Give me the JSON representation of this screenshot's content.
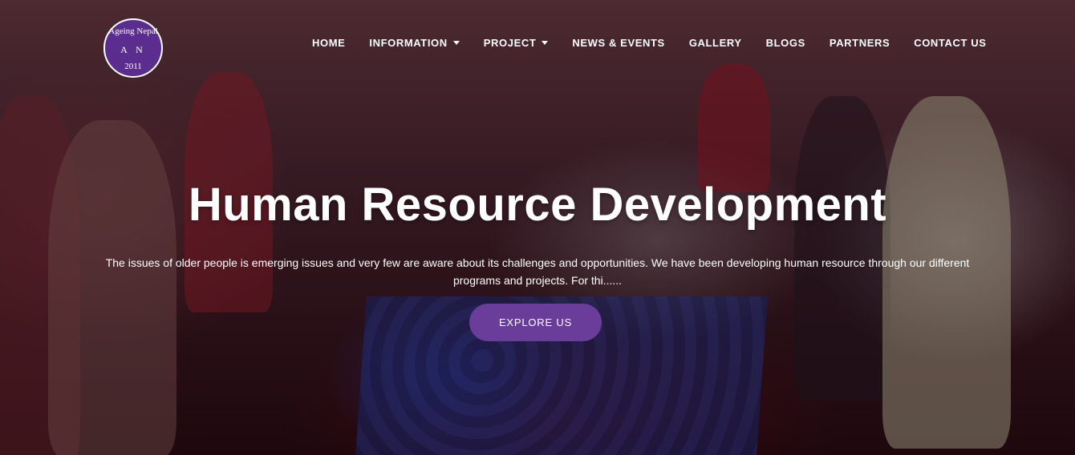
{
  "logo": {
    "text_top": "Ageing Nepal",
    "text_mid": "A N",
    "text_year": "2011",
    "color": "#5b2d8e"
  },
  "nav": {
    "items": [
      {
        "label": "HOME",
        "dropdown": false
      },
      {
        "label": "INFORMATION",
        "dropdown": true
      },
      {
        "label": "PROJECT",
        "dropdown": true
      },
      {
        "label": "NEWS & EVENTS",
        "dropdown": false
      },
      {
        "label": "GALLERY",
        "dropdown": false
      },
      {
        "label": "BLOGS",
        "dropdown": false
      },
      {
        "label": "PARTNERS",
        "dropdown": false
      },
      {
        "label": "CONTACT US",
        "dropdown": false
      }
    ]
  },
  "hero": {
    "title": "Human Resource Development",
    "description": "The issues of older people is emerging issues and very few are aware about its challenges and opportunities. We have been developing human resource through our different programs and projects. For thi......",
    "cta_label": "EXPLORE US",
    "cta_color": "#6a3d9a"
  }
}
